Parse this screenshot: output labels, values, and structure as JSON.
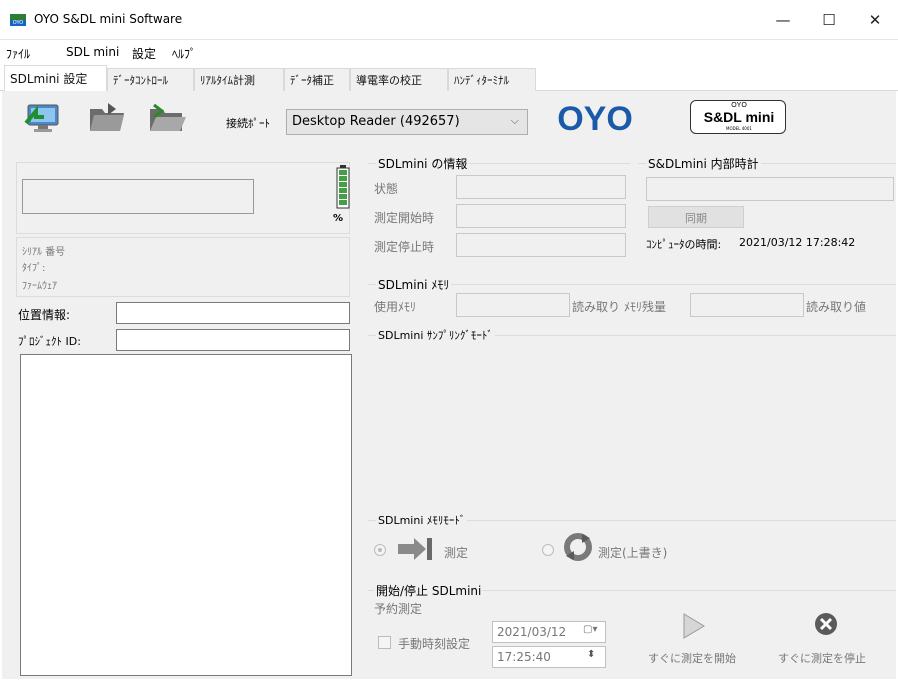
{
  "window": {
    "title": "OYO S&DL mini Software",
    "icon_text": "OYO",
    "minimize": "—",
    "maximize": "☐",
    "close": "✕"
  },
  "menu": [
    "ﾌｧｲﾙ",
    "SDL mini",
    "設定",
    "ﾍﾙﾌﾟ"
  ],
  "tabs": [
    "SDLmini 設定",
    "ﾃﾞｰﾀｺﾝﾄﾛｰﾙ",
    "ﾘｱﾙﾀｲﾑ計測",
    "ﾃﾞｰﾀ補正",
    "導電率の校正",
    "ﾊﾝﾃﾞｨﾀｰﾐﾅﾙ"
  ],
  "toolbar": {
    "port_label": "接続ﾎﾟｰﾄ",
    "port_value": "Desktop Reader (492657)",
    "logo_text": "OYO",
    "badge_top": "OYO",
    "badge_main": "S&DL mini",
    "badge_sub": "MODEL 4001"
  },
  "left": {
    "battery_unit": "%",
    "serial_label": "ｼﾘｱﾙ 番号",
    "type_label": "ﾀｲﾌﾟ:",
    "firmware_label": "ﾌｧｰﾑｳｪｱ",
    "location_label": "位置情報:",
    "project_label": "ﾌﾟﾛｼﾞｪｸﾄ ID:"
  },
  "info": {
    "header": "SDLmini の情報",
    "status": "状態",
    "start_time": "測定開始時",
    "stop_time": "測定停止時"
  },
  "clock": {
    "header": "S&DLmini 内部時計",
    "sync_button": "同期",
    "computer_time_label": "ｺﾝﾋﾟｭｰﾀの時間:",
    "computer_time": "2021/03/12 17:28:42"
  },
  "memory": {
    "header": "SDLmini ﾒﾓﾘ",
    "used_label": "使用ﾒﾓﾘ",
    "read1": "読み取り",
    "remain_label": "ﾒﾓﾘ残量",
    "read2": "読み取り値"
  },
  "sampling": {
    "header": "SDLmini ｻﾝﾌﾟﾘﾝｸﾞﾓｰﾄﾞ"
  },
  "memmode": {
    "header": "SDLmini ﾒﾓﾘﾓｰﾄﾞ",
    "opt1": "測定",
    "opt2": "測定(上書き)"
  },
  "startstop": {
    "header": "開始/停止 SDLmini",
    "scheduled": "予約測定",
    "manual": "手動時刻設定",
    "date": "2021/03/12",
    "time": "17:25:40",
    "start_now": "すぐに測定を開始",
    "stop_now": "すぐに測定を停止"
  }
}
